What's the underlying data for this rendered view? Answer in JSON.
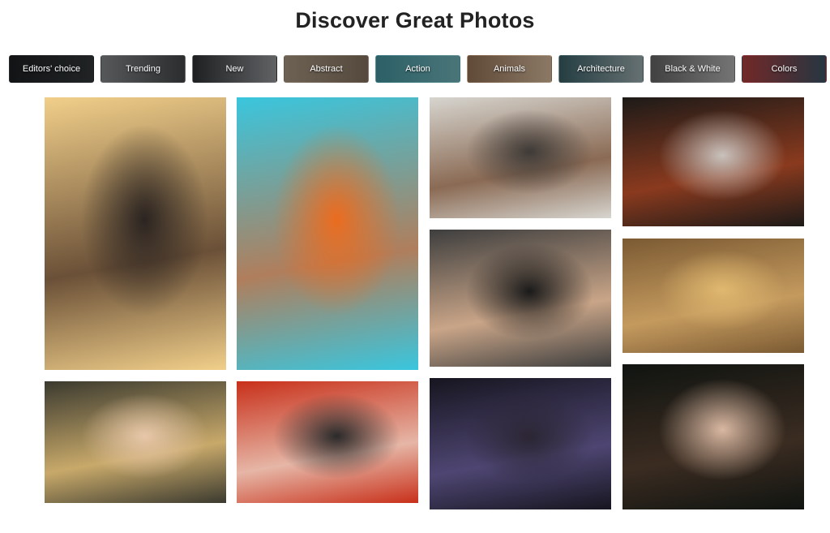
{
  "page": {
    "title": "Discover Great Photos"
  },
  "categories": [
    {
      "label": "Editors' choice",
      "colors": [
        "#1b1d1f",
        "#2f3335"
      ]
    },
    {
      "label": "Trending",
      "colors": [
        "#7b7e80",
        "#3e4143"
      ]
    },
    {
      "label": "New",
      "colors": [
        "#2c2e30",
        "#8b8d90"
      ]
    },
    {
      "label": "Abstract",
      "colors": [
        "#9c8c78",
        "#7a6a58"
      ]
    },
    {
      "label": "Action",
      "colors": [
        "#3f8a93",
        "#6aa8ad"
      ]
    },
    {
      "label": "Animals",
      "colors": [
        "#8a6a50",
        "#c7ad92"
      ]
    },
    {
      "label": "Architecture",
      "colors": [
        "#35595f",
        "#92a1a3"
      ]
    },
    {
      "label": "Black & White",
      "colors": [
        "#5e5e5e",
        "#a7a7a7"
      ]
    },
    {
      "label": "Colors",
      "colors": [
        "#a33a3a",
        "#374e5e"
      ]
    }
  ],
  "photos": [
    {
      "name": "photo-couple-street-sunset",
      "colors": [
        "#f1cf8a",
        "#6a5037",
        "#2b2421"
      ]
    },
    {
      "name": "photo-protest-signs",
      "colors": [
        "#39c6de",
        "#b07e5c",
        "#eb6c1f"
      ]
    },
    {
      "name": "photo-protest-crowd",
      "colors": [
        "#d7d5cf",
        "#8a6a54",
        "#3e3a37"
      ]
    },
    {
      "name": "photo-red-hair-woman",
      "colors": [
        "#1d1a18",
        "#8a3a1e",
        "#c9c2bd"
      ]
    },
    {
      "name": "photo-blonde-praying-hands",
      "colors": [
        "#3e3e3e",
        "#c9a588",
        "#1a1a1a"
      ]
    },
    {
      "name": "photo-woman-shadow-lace",
      "colors": [
        "#7b5a33",
        "#c49a5e",
        "#e0b86f"
      ]
    },
    {
      "name": "photo-girl-straw-hat",
      "colors": [
        "#3b3a2f",
        "#c8a96a",
        "#e7c7a9"
      ]
    },
    {
      "name": "photo-redhead-closeup",
      "colors": [
        "#c8301a",
        "#e6b6a6",
        "#2a2a2a"
      ]
    },
    {
      "name": "photo-painted-face-stars",
      "colors": [
        "#171520",
        "#4e4672",
        "#2b2634"
      ]
    },
    {
      "name": "photo-boy-dark-background",
      "colors": [
        "#101411",
        "#3b2c21",
        "#d9b8a2"
      ]
    }
  ]
}
